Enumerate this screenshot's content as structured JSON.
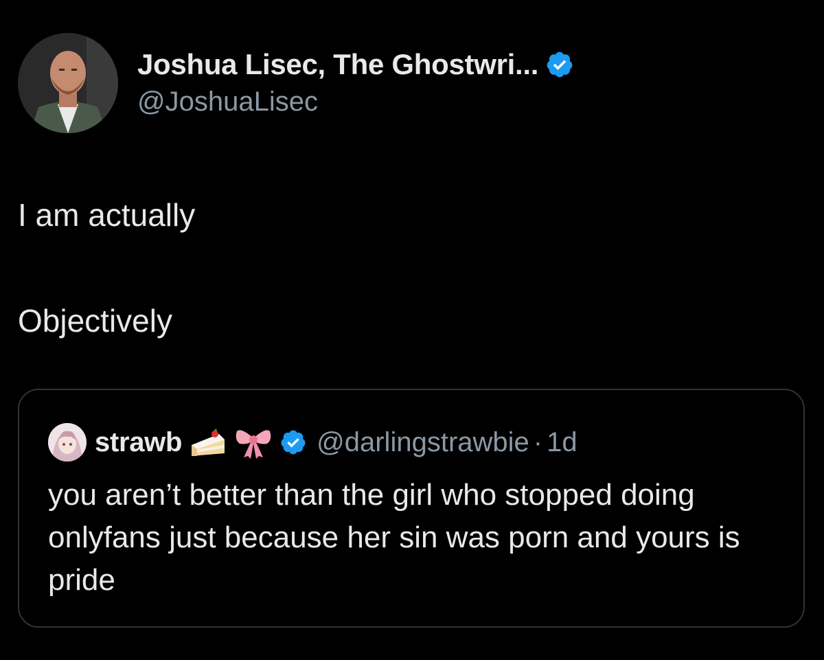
{
  "tweet": {
    "author": {
      "display_name": "Joshua Lisec, The Ghostwri...",
      "handle": "@JoshuaLisec",
      "verified": true,
      "avatar": "man-portrait-avatar"
    },
    "text_lines": [
      "I am actually",
      "Objectively"
    ],
    "quoted_tweet": {
      "author": {
        "display_name": "strawb",
        "name_emojis": [
          "cake-emoji",
          "ribbon-emoji"
        ],
        "handle": "@darlingstrawbie",
        "verified": true,
        "avatar": "anime-girl-avatar"
      },
      "separator": "·",
      "time": "1d",
      "text": "you aren’t better than the girl who stopped doing onlyfans just because her sin was porn and yours is pride"
    }
  },
  "colors": {
    "background": "#000000",
    "primary_text": "#e7e9ea",
    "secondary_text": "#8b98a5",
    "verified_badge": "#1d9bf0",
    "border": "#2f3336"
  }
}
